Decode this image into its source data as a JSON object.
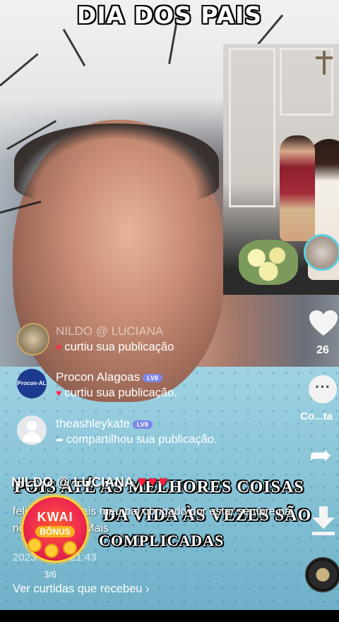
{
  "header": {
    "title": "DIA DOS PAIS"
  },
  "notifications": [
    {
      "name": "NILDO @ LUCIANA",
      "level": "",
      "action": "curtiu sua publicação",
      "action_icon": "heart-icon"
    },
    {
      "name": "Procon Alagoas",
      "level": "LV8",
      "action": "curtiu sua publicação.",
      "action_icon": "heart-icon"
    },
    {
      "name": "theashleykate",
      "level": "LV8",
      "action": "compartilhou sua publicação.",
      "action_icon": "share-arrow-icon"
    }
  ],
  "sidebar": {
    "like_count": "26",
    "comment_label": "Co...ta"
  },
  "post": {
    "poster": "NILDO @ LUCIANA",
    "caption": "feliz dia dos pais meu pai obrigado por estar sempre na nossas vida... Mais",
    "date": "2023-08-13 21:43"
  },
  "overlay_text": {
    "line1": "POIS ATÉ AS MELHORES COISAS",
    "line2": "DA VIDA ÀS VEZES SÃO",
    "line3": "COMPLICADAS"
  },
  "kwai_bonus": {
    "top": "KWAI",
    "bottom": "BÔNUS",
    "counter": "3/6"
  },
  "footer": {
    "view_likes": "Ver curtidas que recebeu"
  },
  "colors": {
    "heart": "#ff2b4a",
    "level_badge": "#7d86e8",
    "kwai_red": "#f02a52",
    "kwai_gold": "#ffd233"
  }
}
